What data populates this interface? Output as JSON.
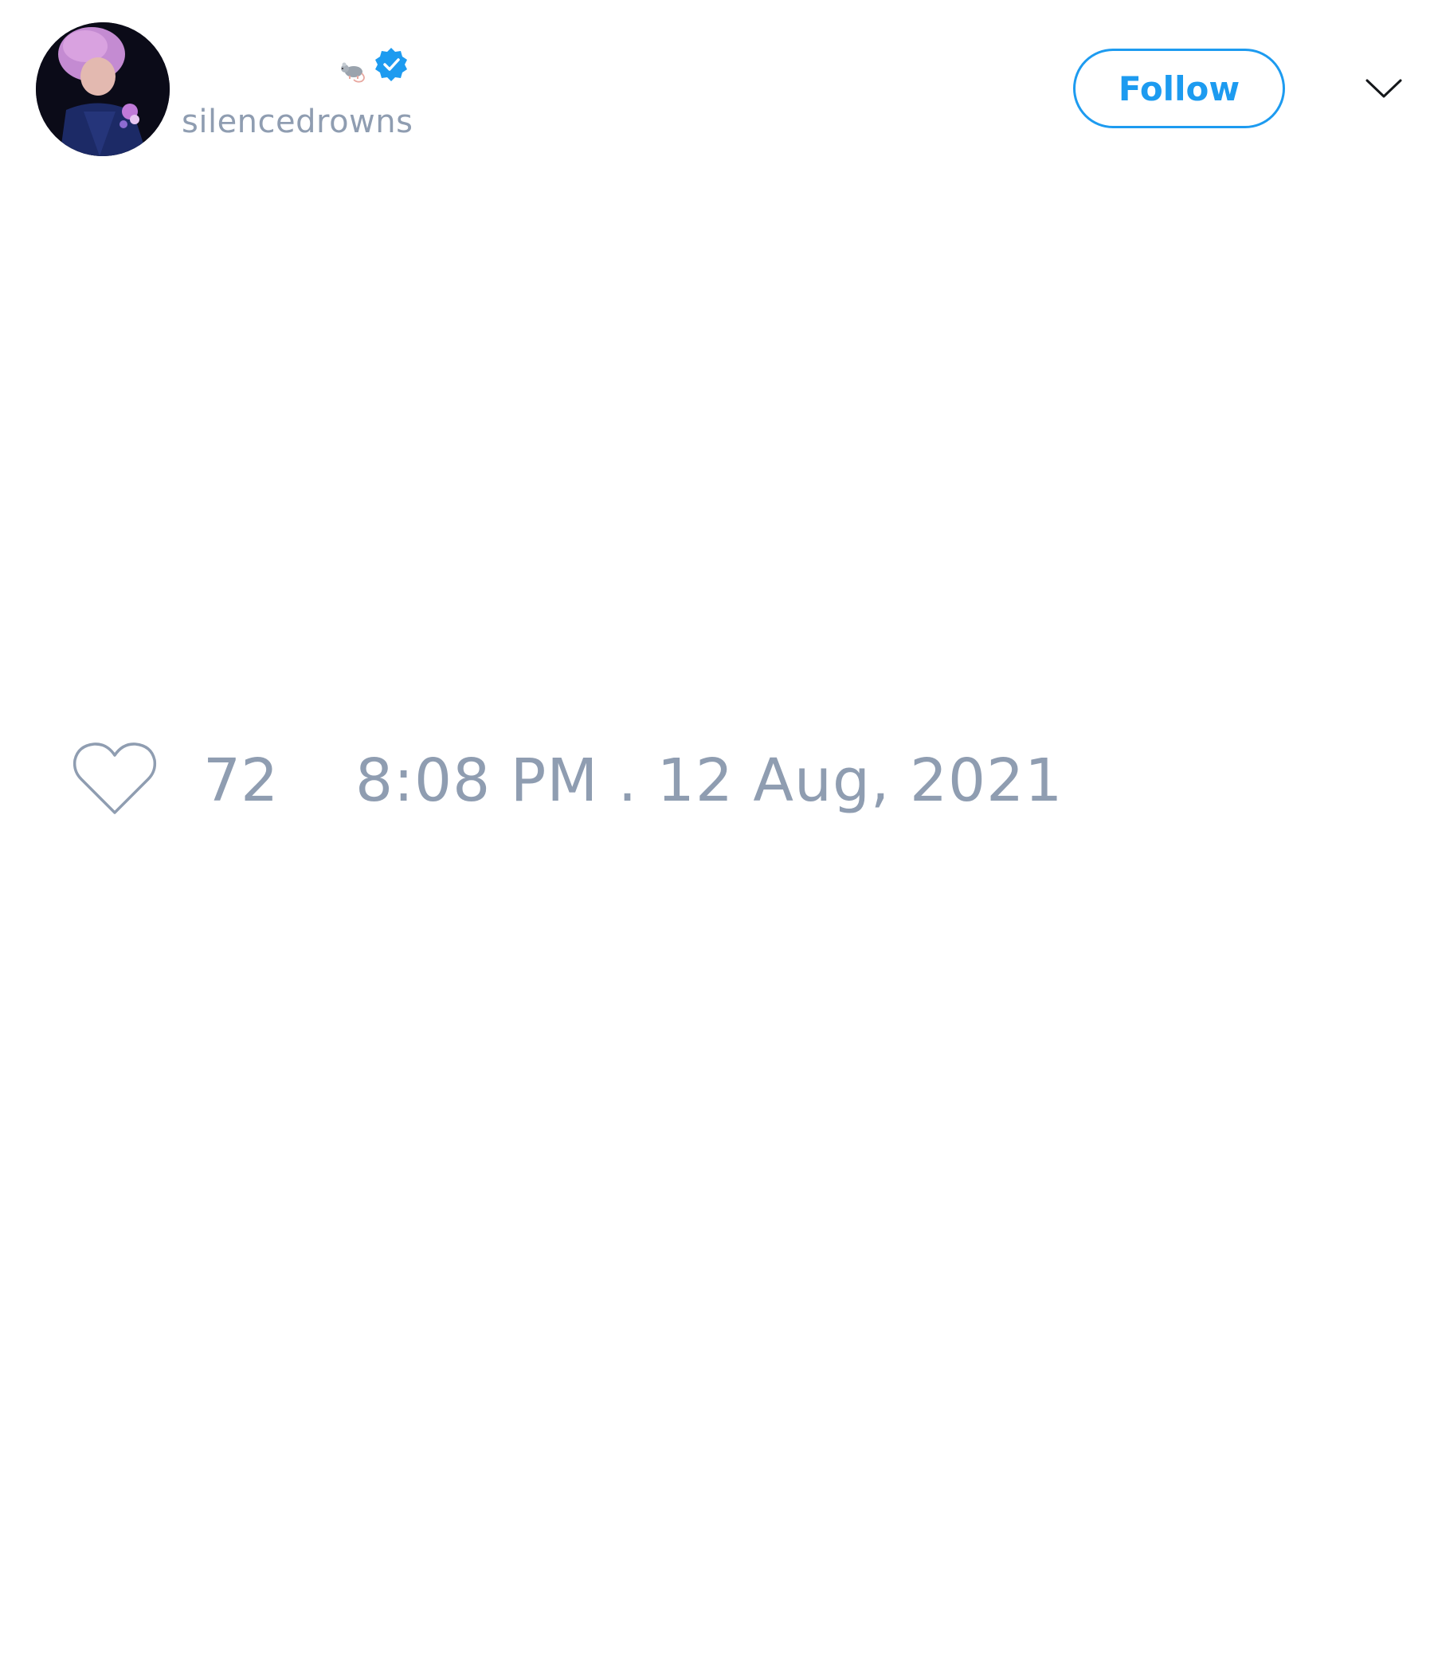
{
  "tweet": {
    "author": {
      "display_name_icons": [
        "rat-icon",
        "verified-badge-icon"
      ],
      "handle": "silencedrowns",
      "verified": true
    },
    "follow_button_label": "Follow",
    "like_count": "72",
    "timestamp": "8:08 PM . 12 Aug, 2021"
  },
  "colors": {
    "accent": "#1d9bf0",
    "muted_text": "#8f9db1",
    "background": "#ffffff"
  },
  "icons": {
    "like": "heart-outline-icon",
    "menu": "chevron-down-icon"
  }
}
